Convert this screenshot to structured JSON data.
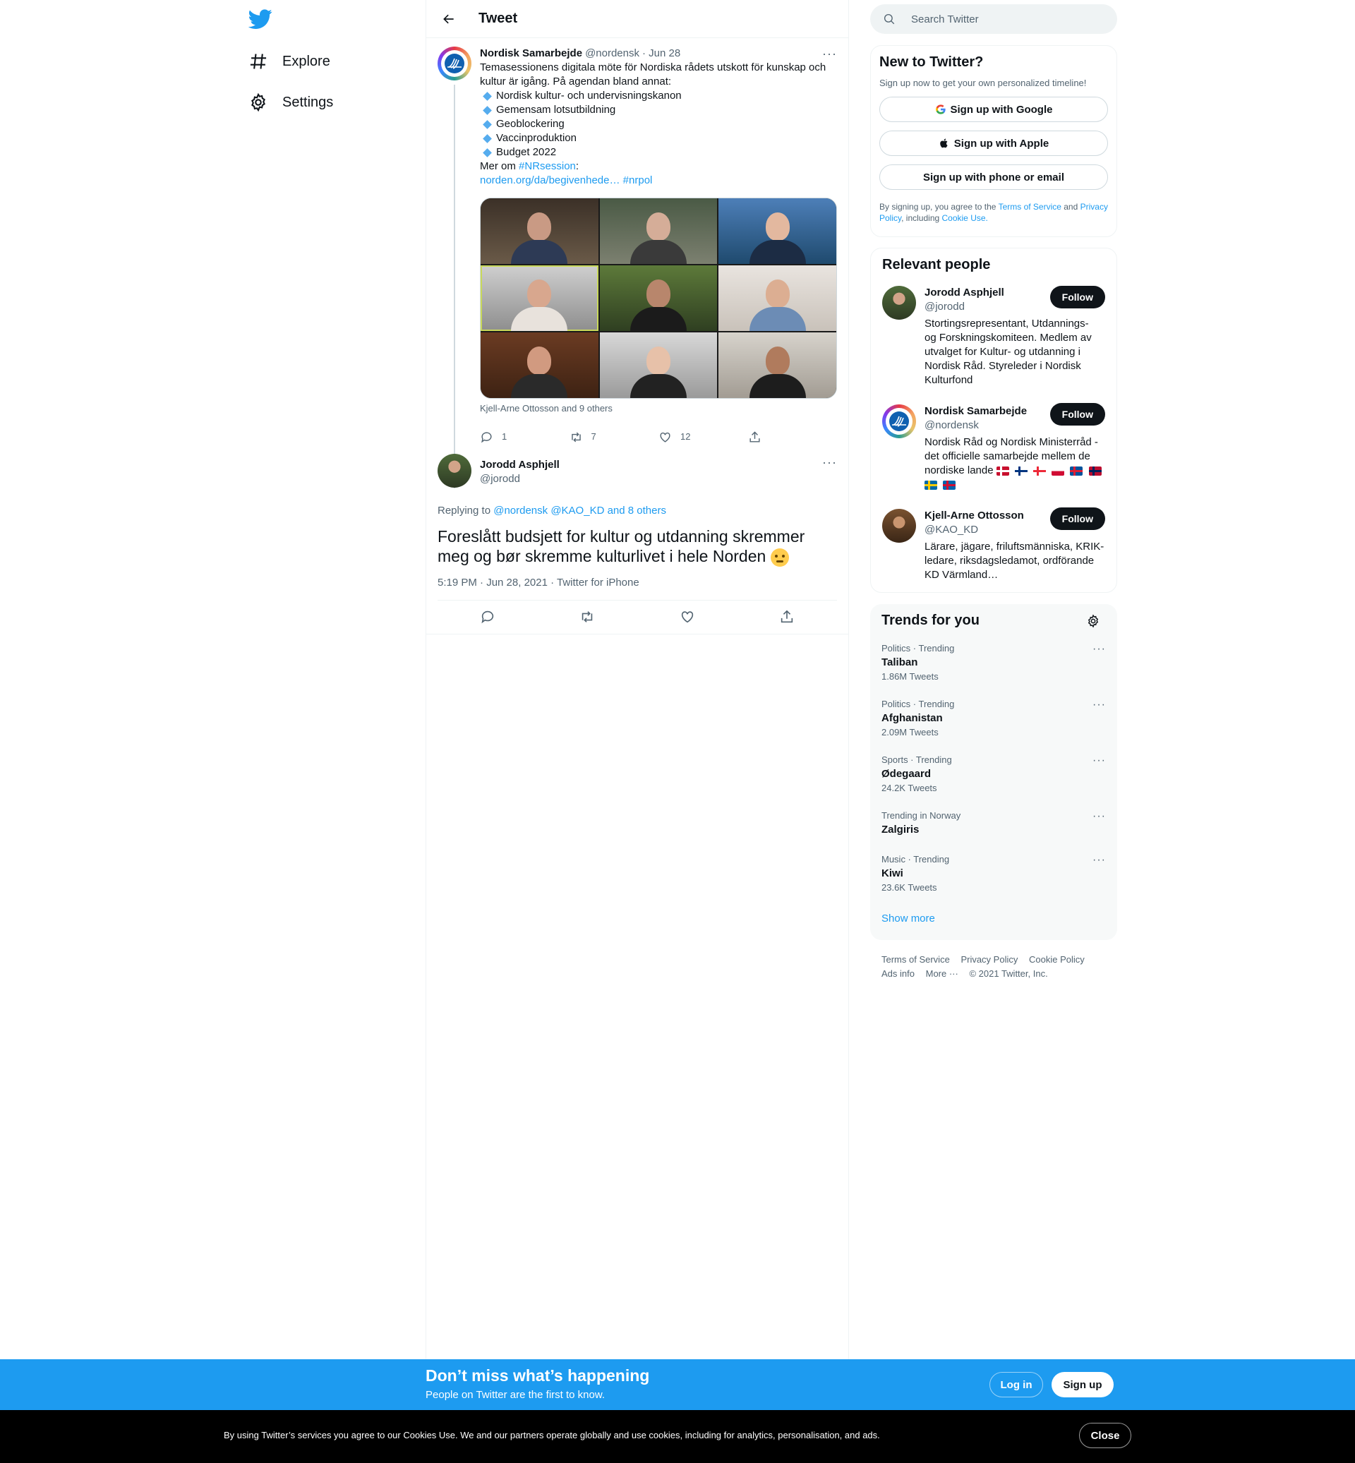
{
  "nav": {
    "items": [
      {
        "label": "Explore",
        "icon": "hashtag-icon"
      },
      {
        "label": "Settings",
        "icon": "gear-icon"
      }
    ]
  },
  "header": {
    "title": "Tweet"
  },
  "parent_tweet": {
    "name": "Nordisk Samarbejde",
    "handle": "@nordensk",
    "date": "· Jun 28",
    "text_line1": "Temasessionens digitala möte för Nordiska rådets utskott för kunskap och",
    "text_line2": "kultur är igång. På agendan bland annat:",
    "bullets": [
      "Nordisk kultur- och undervisningskanon",
      "Gemensam lotsutbildning",
      "Geoblockering",
      "Vaccinproduktion",
      "Budget 2022"
    ],
    "more_prefix": "Mer om ",
    "hashtag1": "#NRsession",
    "colon": ":",
    "link": "norden.org/da/begivenhede…",
    "hashtag2": "#nrpol",
    "tagged": "Kjell-Arne Ottosson and 9 others",
    "replies": "1",
    "retweets": "7",
    "likes": "12"
  },
  "main_tweet": {
    "name": "Jorodd Asphjell",
    "handle": "@jorodd",
    "replying_prefix": "Replying to ",
    "replying_users": "@nordensk @KAO_KD and 8 others",
    "text": "Foreslått budsjett for kultur og utdanning skremmer meg og bør skremme kulturlivet i hele Norden",
    "timestamp": "5:19 PM · Jun 28, 2021 · Twitter for iPhone"
  },
  "search": {
    "placeholder": "Search Twitter"
  },
  "signup_card": {
    "title": "New to Twitter?",
    "subtitle": "Sign up now to get your own personalized timeline!",
    "google": "Sign up with Google",
    "apple": "Sign up with Apple",
    "phone": "Sign up with phone or email",
    "legal_1": "By signing up, you agree to the ",
    "tos": "Terms of Service",
    "legal_2": " and ",
    "privacy": "Privacy Policy",
    "legal_3": ", including ",
    "cookie": "Cookie Use."
  },
  "relevant": {
    "title": "Relevant people",
    "follow_label": "Follow",
    "people": [
      {
        "name": "Jorodd Asphjell",
        "handle": "@jorodd",
        "bio": "Stortingsrepresentant, Utdannings- og Forskningskomiteen. Medlem av utvalget for Kultur- og utdanning i Nordisk Råd. Styreleder i Nordisk Kulturfond"
      },
      {
        "name": "Nordisk Samarbejde",
        "handle": "@nordensk",
        "bio": "Nordisk Råd og Nordisk Ministerråd - det officielle samarbejde mellem de nordiske lande"
      },
      {
        "name": "Kjell-Arne Ottosson",
        "handle": "@KAO_KD",
        "bio": "Lärare, jägare, friluftsmänniska, KRIK-ledare, riksdagsledamot, ordförande KD Värmland…"
      }
    ]
  },
  "trends": {
    "title": "Trends for you",
    "items": [
      {
        "category": "Politics · Trending",
        "name": "Taliban",
        "count": "1.86M Tweets"
      },
      {
        "category": "Politics · Trending",
        "name": "Afghanistan",
        "count": "2.09M Tweets"
      },
      {
        "category": "Sports · Trending",
        "name": "Ødegaard",
        "count": "24.2K Tweets"
      },
      {
        "category": "Trending in Norway",
        "name": "Zalgiris",
        "count": ""
      },
      {
        "category": "Music · Trending",
        "name": "Kiwi",
        "count": "23.6K Tweets"
      }
    ],
    "show_more": "Show more"
  },
  "footer": {
    "links": [
      "Terms of Service",
      "Privacy Policy",
      "Cookie Policy",
      "Ads info",
      "More ···"
    ],
    "copyright": "© 2021 Twitter, Inc."
  },
  "bottom_bar": {
    "title": "Don’t miss what’s happening",
    "subtitle": "People on Twitter are the first to know.",
    "login": "Log in",
    "signup": "Sign up"
  },
  "cookie_bar": {
    "text": "By using Twitter’s services you agree to our Cookies Use. We and our partners operate globally and use cookies, including for analytics, personalisation, and ads.",
    "close": "Close"
  },
  "colors": {
    "accent": "#1d9bf0",
    "text": "#0f1419",
    "secondary": "#536471"
  }
}
